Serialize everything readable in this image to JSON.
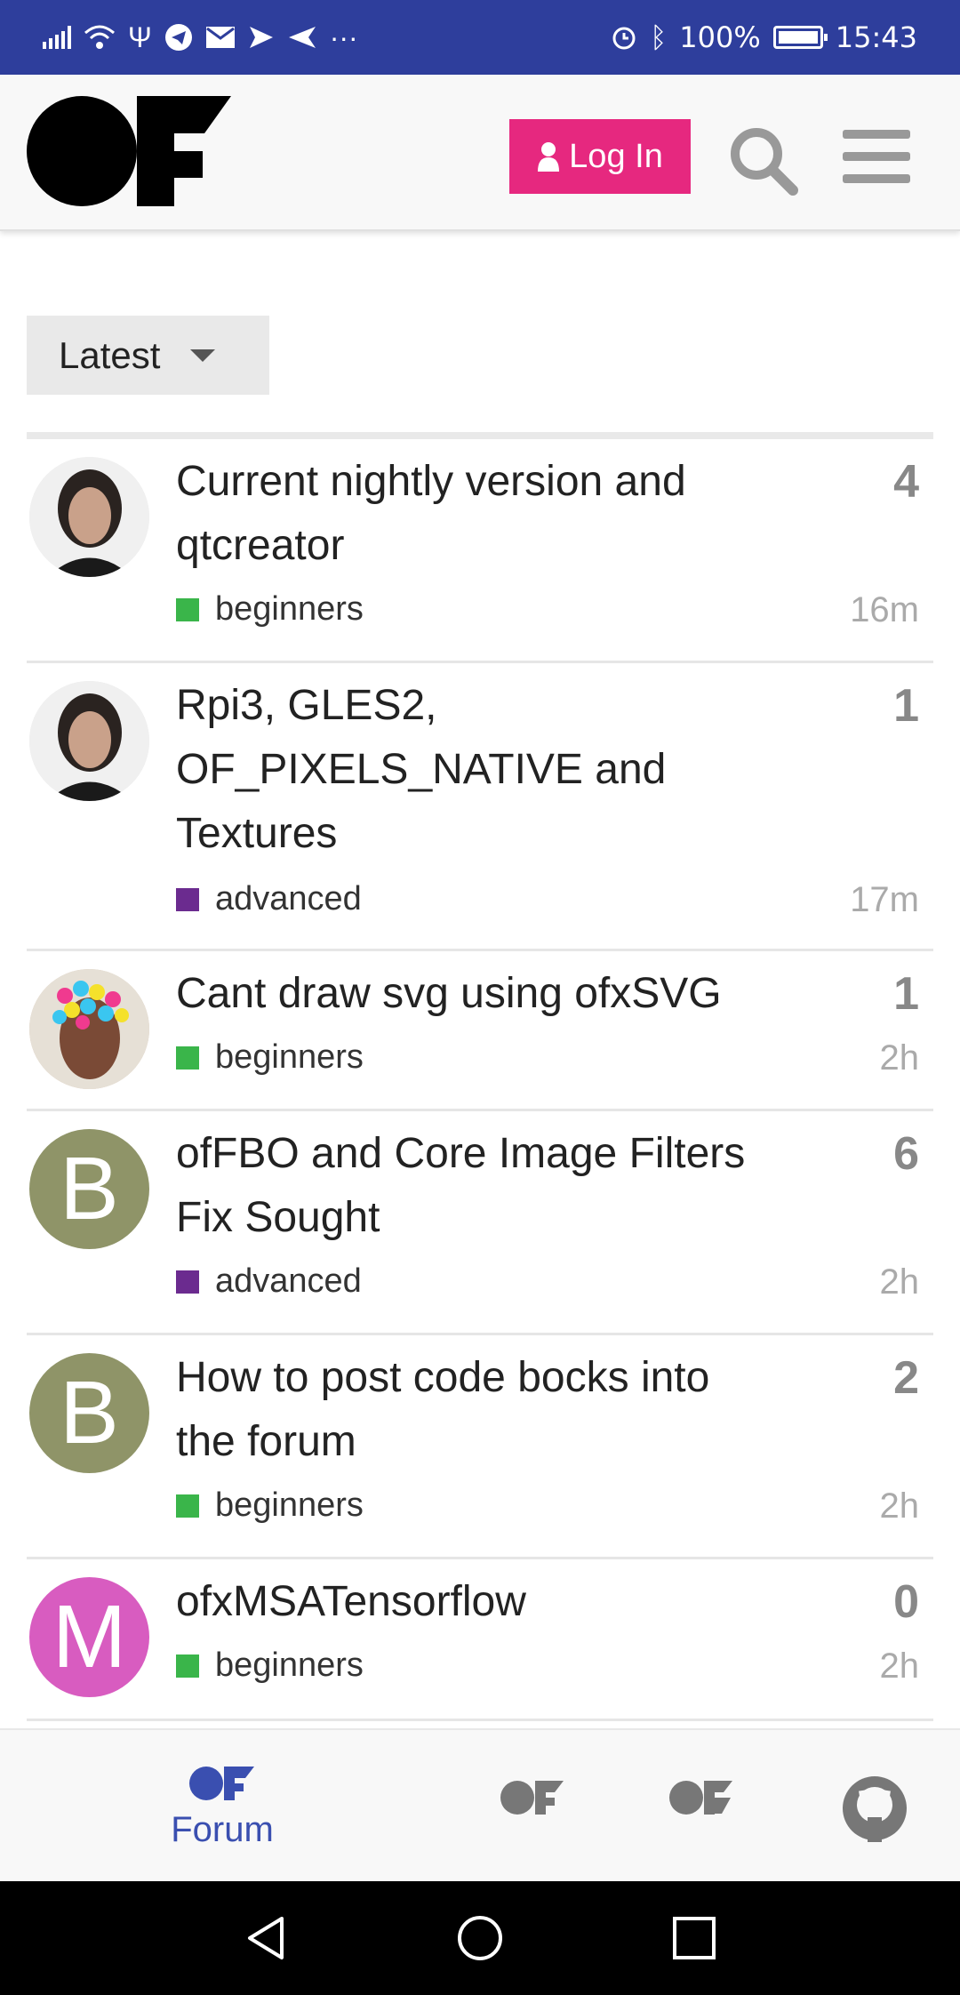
{
  "status_bar": {
    "battery": "100%",
    "time": "15:43",
    "more": "···"
  },
  "header": {
    "login_label": "Log In"
  },
  "filter": {
    "label": "Latest"
  },
  "colors": {
    "brand": "#2e3e9c",
    "login": "#e6287f",
    "beginners": "#3ab54a",
    "advanced": "#6b2b8f"
  },
  "topics": [
    {
      "title": "Current nightly version and qtcreator",
      "category": "beginners",
      "count": "4",
      "age": "16m",
      "avatar": "photo-icon"
    },
    {
      "title": "Rpi3, GLES2, OF_PIXELS_NATIVE and Textures",
      "category": "advanced",
      "count": "1",
      "age": "17m",
      "avatar": "photo-icon"
    },
    {
      "title": "Cant draw svg using ofxSVG",
      "category": "beginners",
      "count": "1",
      "age": "2h",
      "avatar": "photo-icon"
    },
    {
      "title": "ofFBO and Core Image Filters Fix Sought",
      "category": "advanced",
      "count": "6",
      "age": "2h",
      "avatar": "B"
    },
    {
      "title": "How to post code bocks into the forum",
      "category": "beginners",
      "count": "2",
      "age": "2h",
      "avatar": "B"
    },
    {
      "title": "ofxMSATensorflow",
      "category": "beginners",
      "count": "0",
      "age": "2h",
      "avatar": "M"
    }
  ],
  "bottom_nav": {
    "forum_label": "Forum"
  }
}
